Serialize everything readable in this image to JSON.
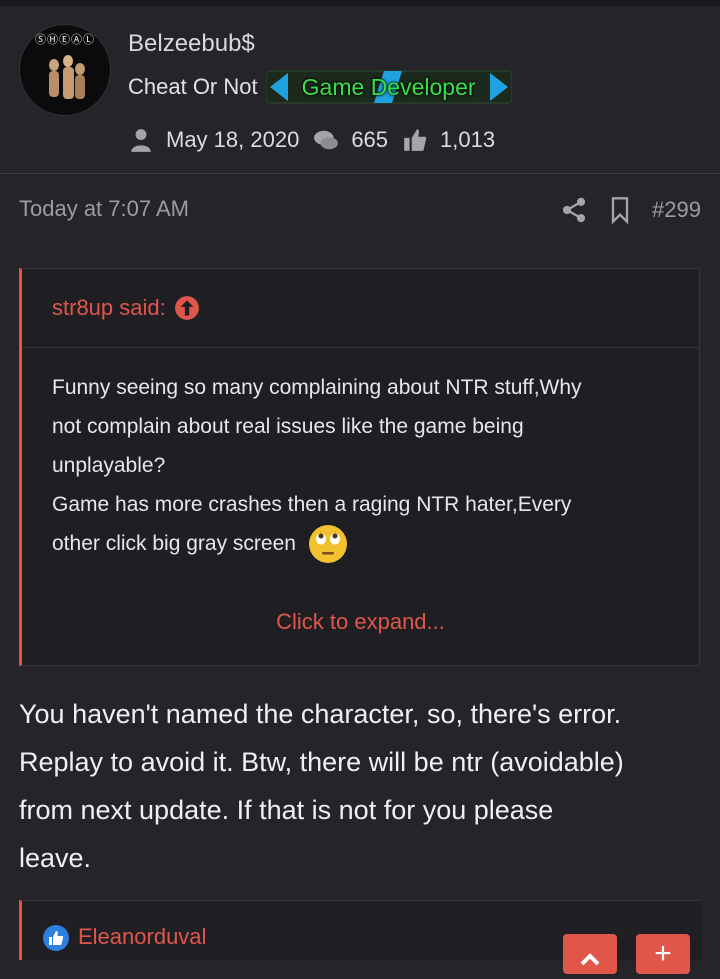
{
  "user": {
    "avatar_badges": "ⓈⒽⒺⒶⓁ",
    "name": "Belzeebub$",
    "title": "Cheat Or Not",
    "banner": "Game Developer",
    "joined": "May 18, 2020",
    "messages": "665",
    "reactions": "1,013"
  },
  "post": {
    "time": "Today at 7:07 AM",
    "number": "#299",
    "icons": [
      "share-icon",
      "bookmark-icon"
    ]
  },
  "quote": {
    "author": "str8up said:",
    "lines": [
      "Funny seeing so many complaining about NTR stuff,Why",
      "not complain about real issues like the game being",
      "unplayable?",
      "Game has more crashes then a raging NTR hater,Every",
      "other click big gray screen"
    ],
    "expand": "Click to expand..."
  },
  "message": {
    "lines": [
      "You haven't named the character, so, there's error.",
      "Replay to avoid it. Btw, there will be ntr (avoidable)",
      "from next update. If that is not for you please",
      "leave."
    ]
  },
  "reaction": {
    "user": "Eleanorduval",
    "plus": "+"
  },
  "colors": {
    "accent": "#e0564a",
    "background": "#242429",
    "banner_text": "#37e04a",
    "banner_arrows": "#1fa3e0"
  }
}
